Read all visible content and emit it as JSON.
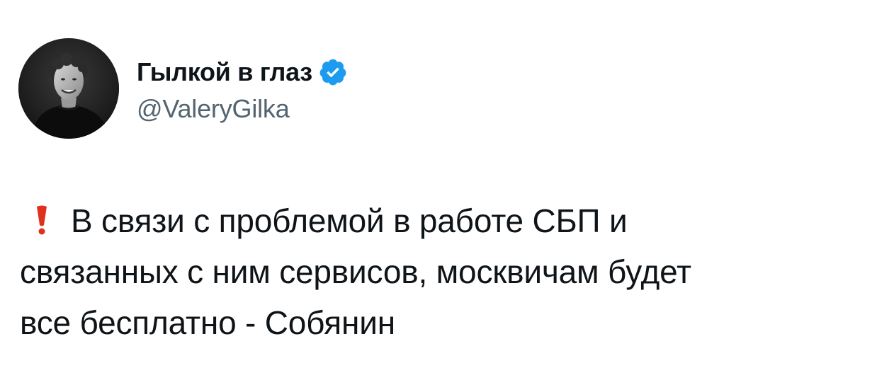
{
  "tweet": {
    "author": {
      "display_name": "Гылкой в глаз",
      "handle": "@ValeryGilka",
      "verified": true,
      "avatar_icon": "user-avatar-photo",
      "verified_icon": "verified-badge-icon",
      "verified_color": "#1d9bf0"
    },
    "body": {
      "emoji": "red-exclamation-mark-icon",
      "emoji_color": "#e0301e",
      "lines": [
        "В связи с проблемой в работе СБП и",
        "связанных с ним сервисов, москвичам будет",
        "все бесплатно - Собянин"
      ]
    }
  }
}
